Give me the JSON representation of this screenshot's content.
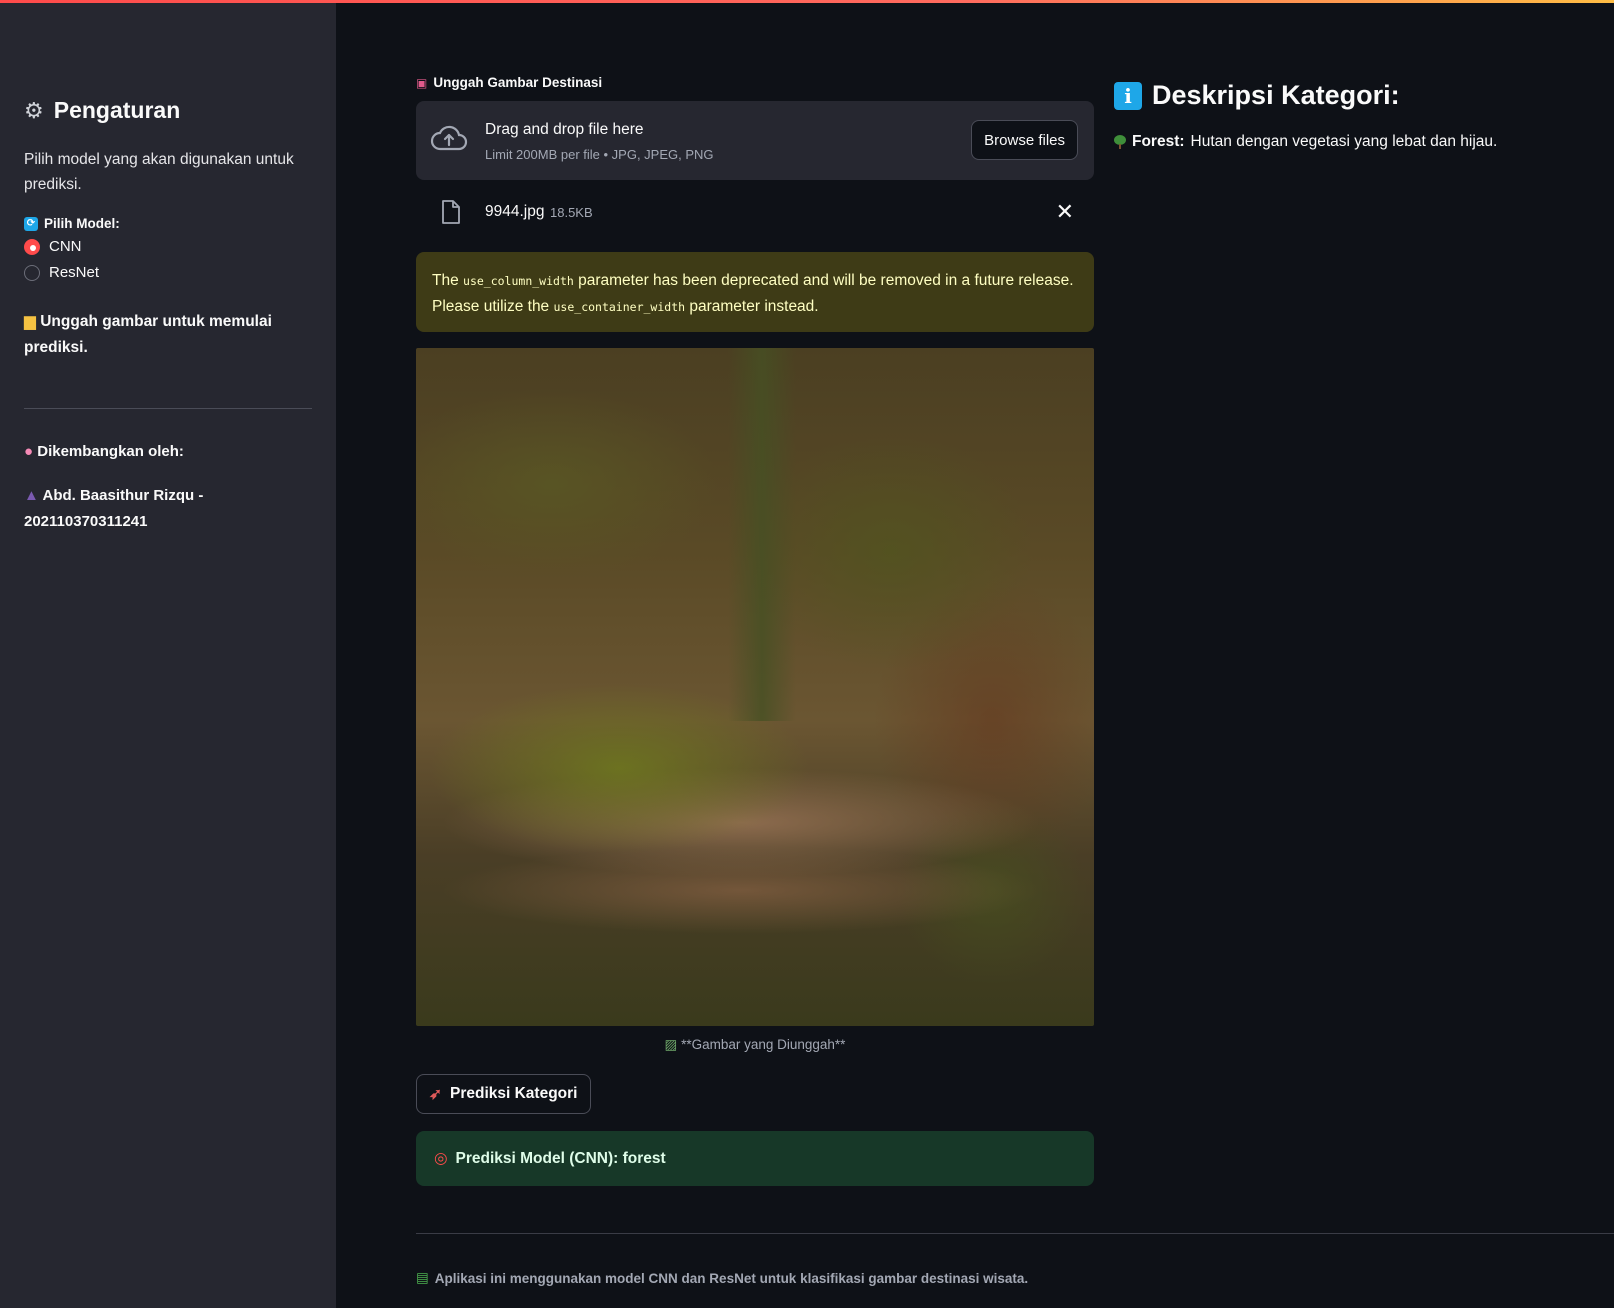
{
  "sidebar": {
    "title": "Pengaturan",
    "title_icon": "⚙",
    "description": "Pilih model yang akan digunakan untuk prediksi.",
    "model_label": "Pilih Model:",
    "model_options": [
      "CNN",
      "ResNet"
    ],
    "selected_model": "CNN",
    "upload_note": "Unggah gambar untuk memulai prediksi.",
    "developed_by": "Dikembangkan oleh:",
    "author": "Abd. Baasithur Rizqu - 202110370311241"
  },
  "uploader": {
    "label": "Unggah Gambar Destinasi",
    "drop_title": "Drag and drop file here",
    "drop_sub": "Limit 200MB per file • JPG, JPEG, PNG",
    "browse_label": "Browse files",
    "file_name": "9944.jpg",
    "file_size": "18.5KB"
  },
  "warning": {
    "p1": "The ",
    "code1": "use_column_width",
    "p2": " parameter has been deprecated and will be removed in a future release. Please utilize the ",
    "code2": "use_container_width",
    "p3": " parameter instead."
  },
  "image": {
    "caption": "**Gambar yang Diunggah**"
  },
  "predict_button": "Prediksi Kategori",
  "result": "Prediksi Model (CNN): forest",
  "footer": "Aplikasi ini menggunakan model CNN dan ResNet untuk klasifikasi gambar destinasi wisata.",
  "description": {
    "title": "Deskripsi Kategori:",
    "category_name": "Forest:",
    "category_text": "Hutan dengan vegetasi yang lebat dan hijau."
  },
  "colors": {
    "accent": "#ff4b4b",
    "background": "#0e1117",
    "sidebar": "#262730",
    "warning_bg": "#3e3b16",
    "success_bg": "#173828",
    "info": "#1ea7e8"
  }
}
